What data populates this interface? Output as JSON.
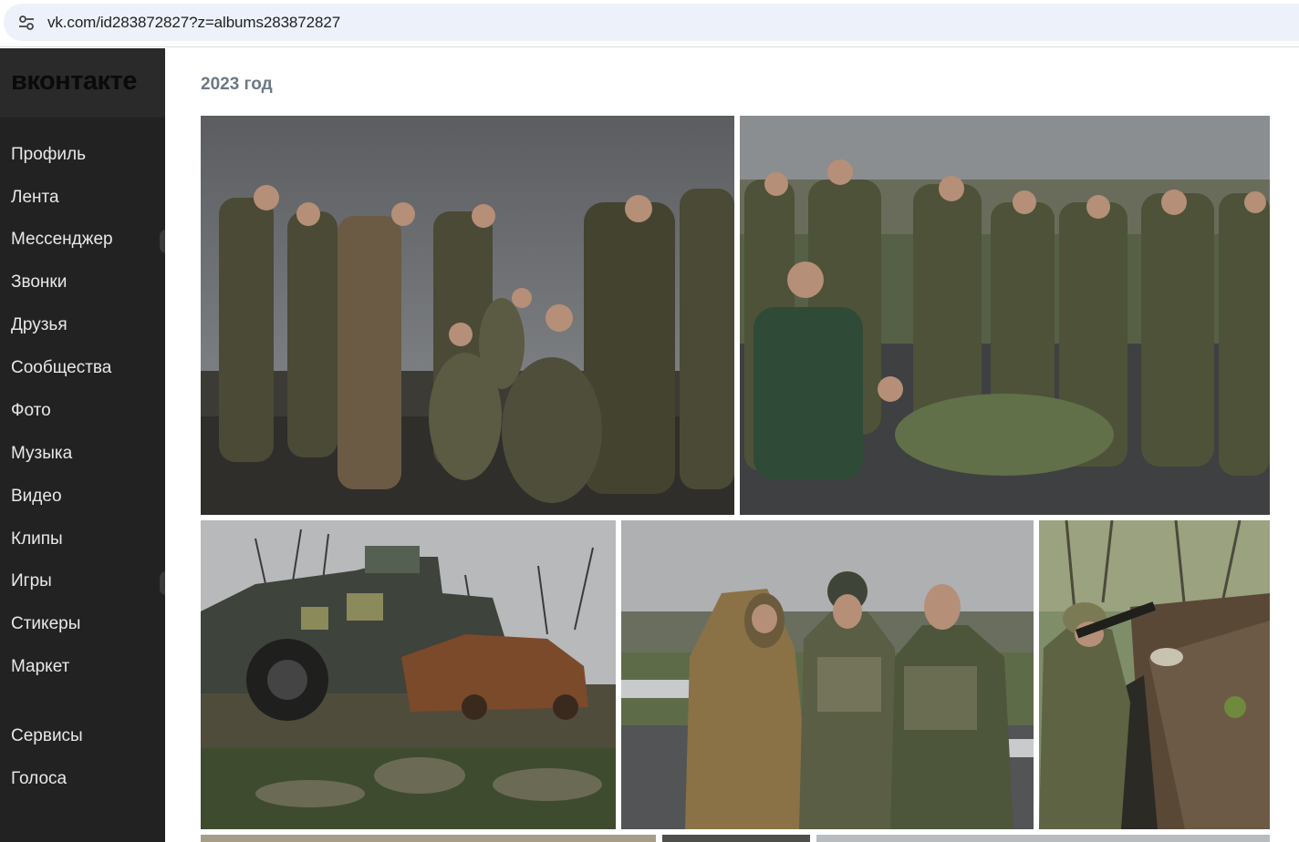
{
  "browser": {
    "url": "vk.com/id283872827?z=albums283872827",
    "site_icon": "tune-icon"
  },
  "sidebar": {
    "logo": "вконтакте",
    "items": [
      {
        "label": "Профиль"
      },
      {
        "label": "Лента"
      },
      {
        "label": "Мессенджер"
      },
      {
        "label": "Звонки"
      },
      {
        "label": "Друзья"
      },
      {
        "label": "Сообщества"
      },
      {
        "label": "Фото"
      },
      {
        "label": "Музыка"
      },
      {
        "label": "Видео"
      },
      {
        "label": "Клипы"
      },
      {
        "label": "Игры"
      },
      {
        "label": "Стикеры"
      },
      {
        "label": "Маркет"
      },
      {
        "label": "Сервисы"
      },
      {
        "label": "Голоса"
      }
    ]
  },
  "album": {
    "year_heading": "2023 год",
    "photos": [
      {
        "subject": "group of soldiers on road"
      },
      {
        "subject": "group of soldiers near field"
      },
      {
        "subject": "destroyed armored vehicle and burnt car"
      },
      {
        "subject": "three men in camouflage by road barrier"
      },
      {
        "subject": "soldier aiming rifle from trench"
      }
    ]
  },
  "colors": {
    "sidebar_bg": "#222222",
    "sidebar_text": "#e8e8e8",
    "year_text": "#6d7885",
    "omnibox_bg": "#edf2fa"
  }
}
